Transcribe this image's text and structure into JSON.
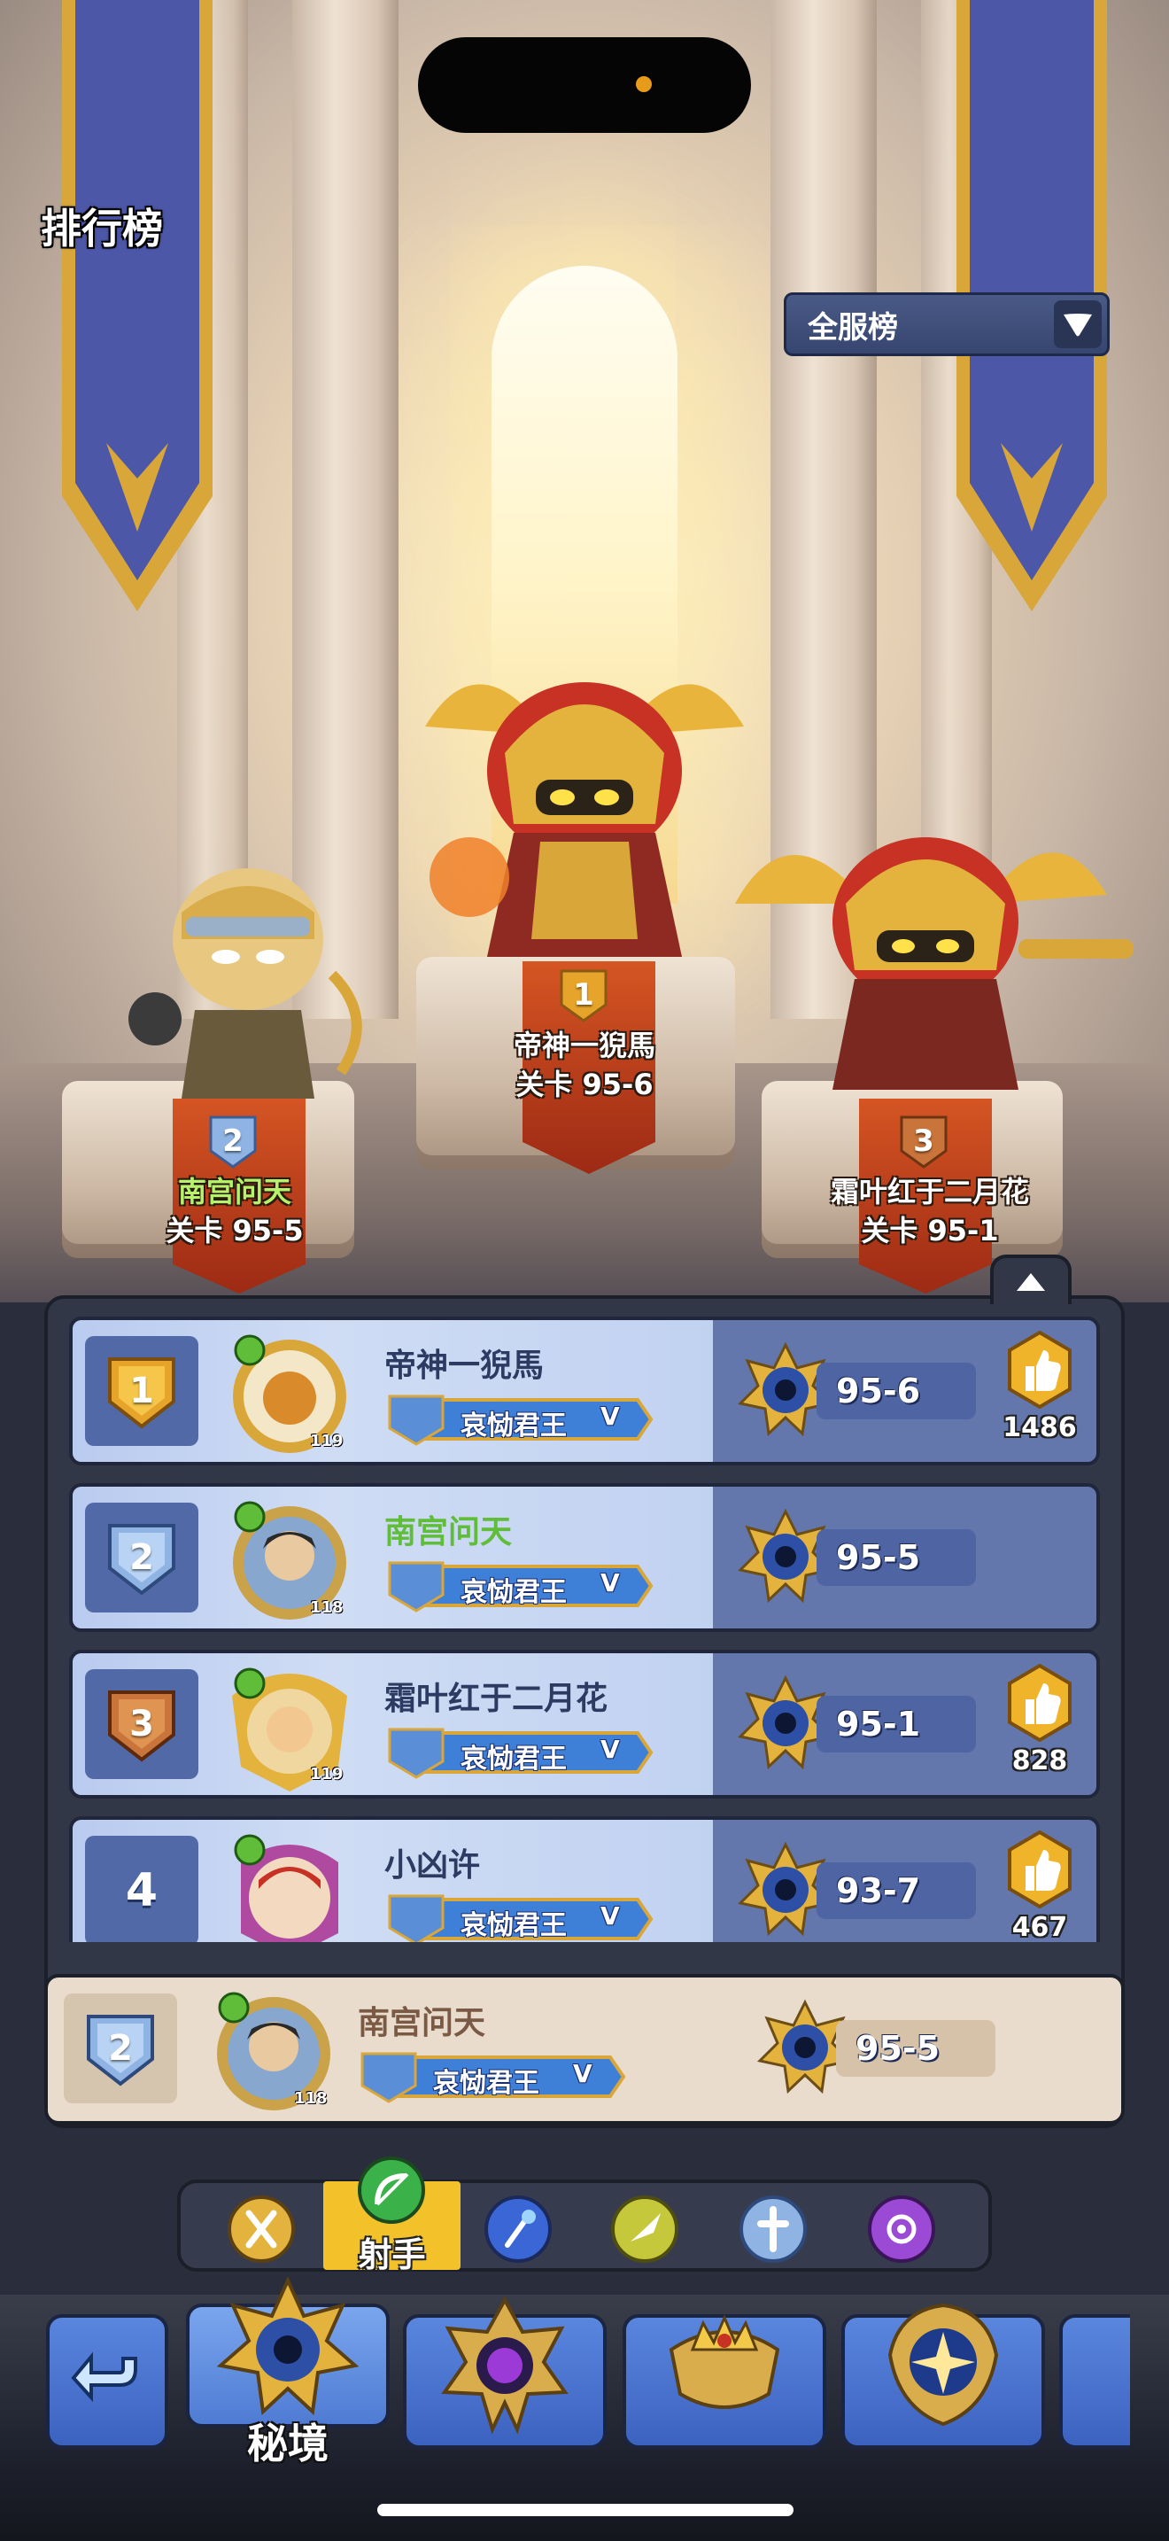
{
  "header": {
    "title": "排行榜"
  },
  "server_select": {
    "selected": "全服榜"
  },
  "podium": [
    {
      "rank": "1",
      "name": "帝神一猊馬",
      "stage": "关卡 95-6"
    },
    {
      "rank": "2",
      "name": "南宫问天",
      "stage": "关卡 95-5"
    },
    {
      "rank": "3",
      "name": "霜叶红于二月花",
      "stage": "关卡 95-1"
    }
  ],
  "rows": [
    {
      "rank": "1",
      "name": "帝神一猊馬",
      "level": "119",
      "title": "哀恸君王",
      "title_suffix": "V",
      "stage": "95-6",
      "likes": "1486"
    },
    {
      "rank": "2",
      "name": "南宫问天",
      "level": "118",
      "title": "哀恸君王",
      "title_suffix": "V",
      "stage": "95-5",
      "likes": ""
    },
    {
      "rank": "3",
      "name": "霜叶红于二月花",
      "level": "119",
      "title": "哀恸君王",
      "title_suffix": "V",
      "stage": "95-1",
      "likes": "828"
    },
    {
      "rank": "4",
      "name": "小凶许",
      "level": "",
      "title": "哀恸君王",
      "title_suffix": "V",
      "stage": "93-7",
      "likes": "467"
    }
  ],
  "my_row": {
    "rank": "2",
    "name": "南宫问天",
    "level": "118",
    "title": "哀恸君王",
    "title_suffix": "V",
    "stage": "95-5"
  },
  "class_tabs": {
    "selected_label": "射手",
    "icons": [
      "warrior-class-icon",
      "archer-class-icon",
      "mage-class-icon",
      "assassin-class-icon",
      "priest-class-icon",
      "summoner-class-icon"
    ]
  },
  "bottom_nav": {
    "active_label": "秘境"
  },
  "colors": {
    "rank1": "#e7a42a",
    "rank2": "#8fb4e4",
    "rank3": "#c9743a",
    "panel": "#313746",
    "row": "#6477ad",
    "accent_gold": "#f3c22a"
  }
}
